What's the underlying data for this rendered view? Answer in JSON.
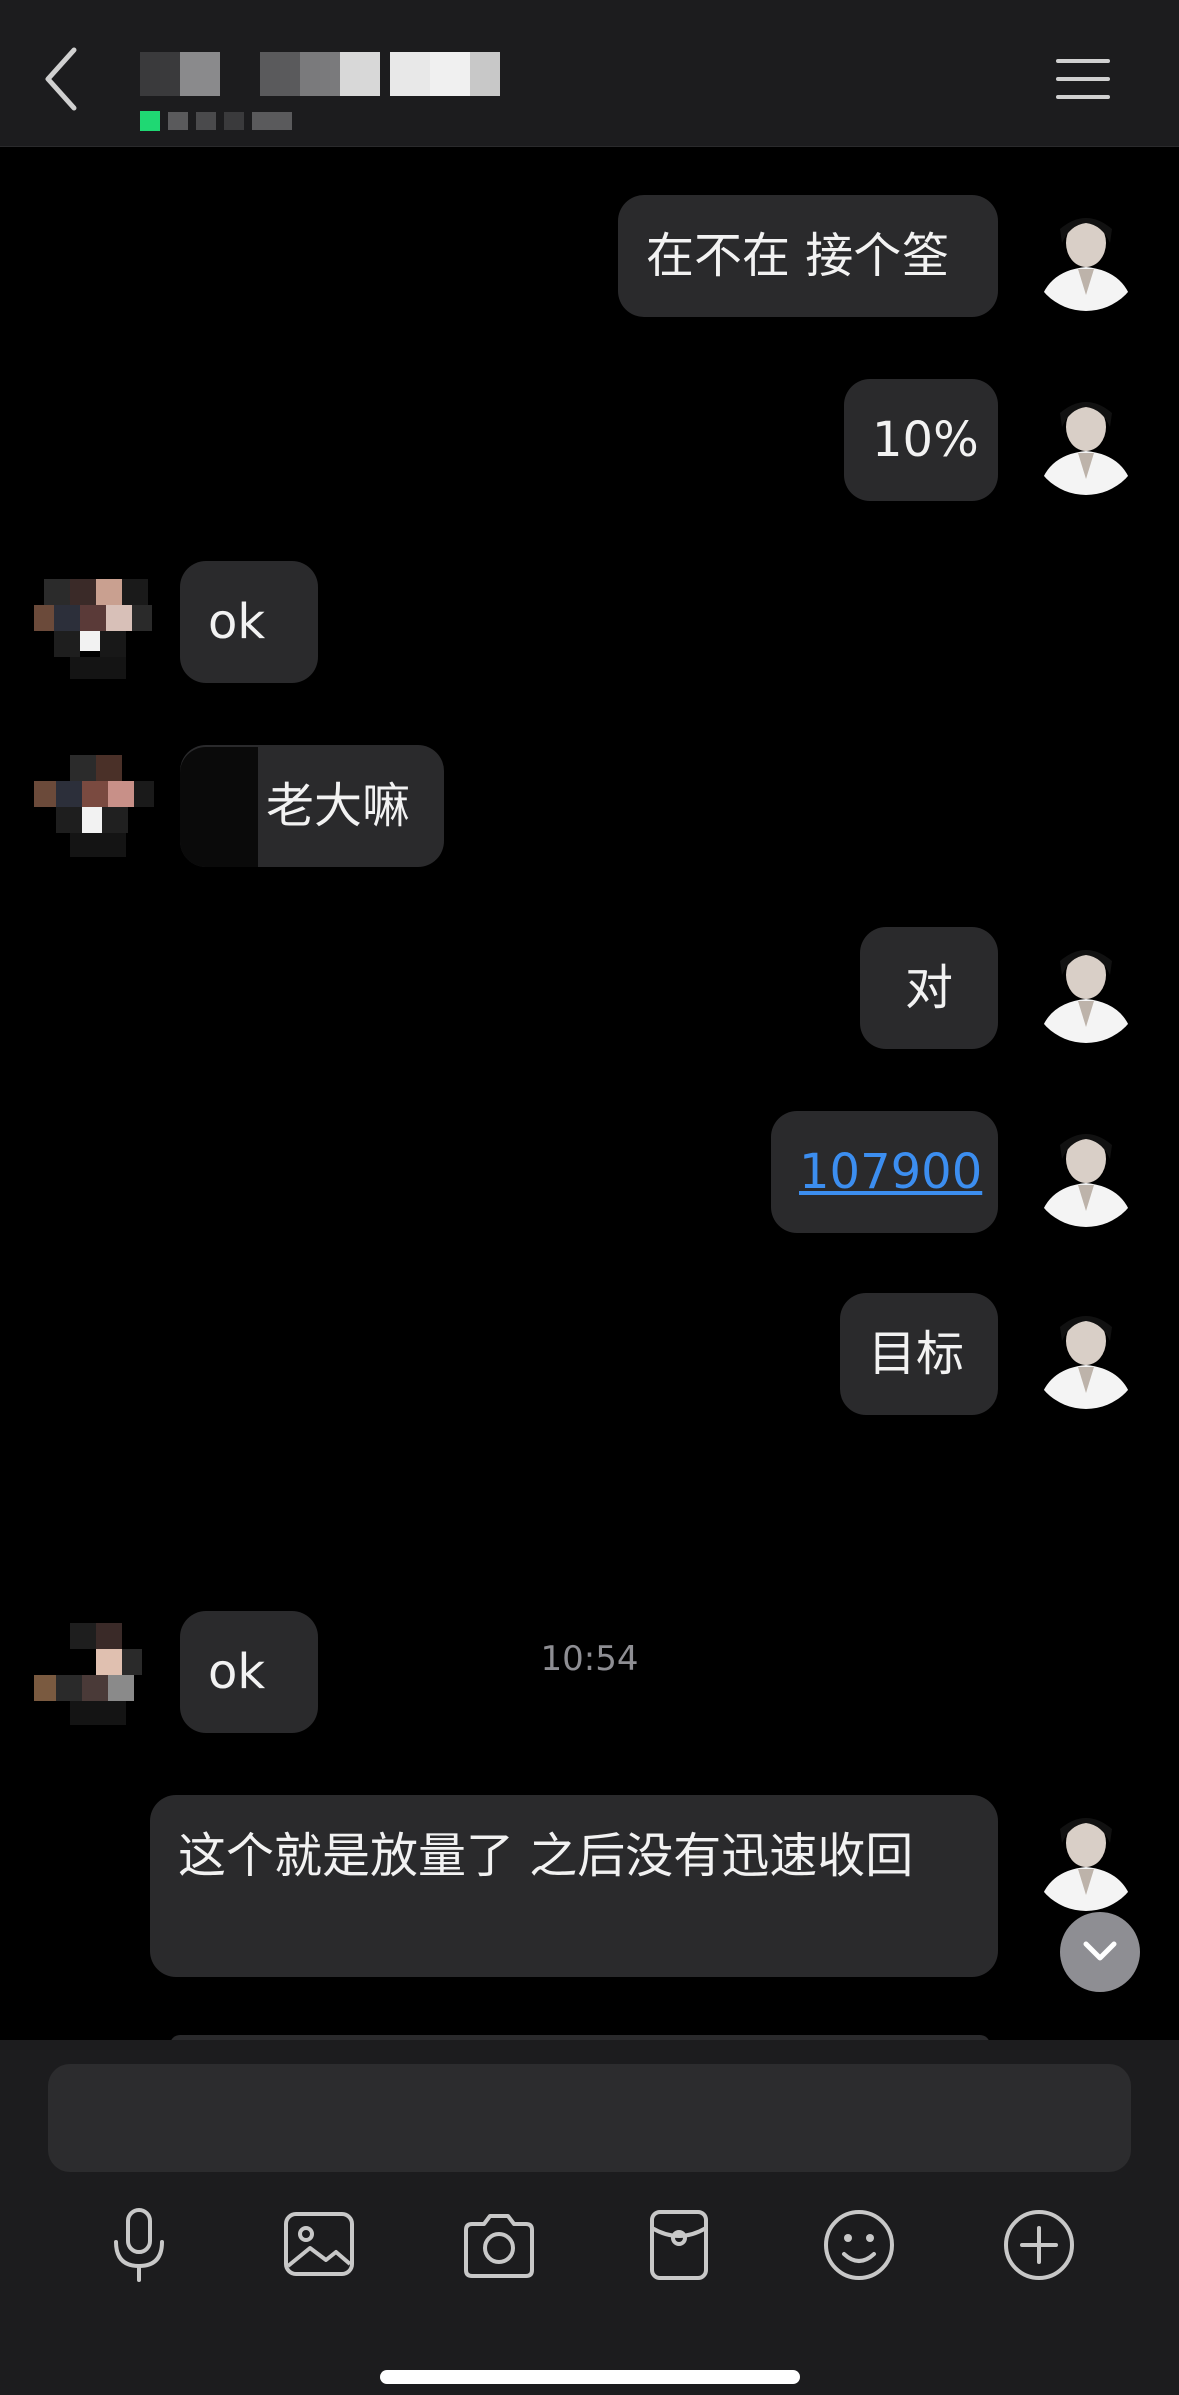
{
  "header": {
    "contact_name_redacted": true
  },
  "messages": [
    {
      "side": "right",
      "text": "在不在 接个筌"
    },
    {
      "side": "right",
      "text": "10%"
    },
    {
      "side": "left",
      "text": "ok"
    },
    {
      "side": "left",
      "text": "老大嘛"
    },
    {
      "side": "right",
      "text": "对"
    },
    {
      "side": "right",
      "text": "107900"
    },
    {
      "side": "right",
      "text": "目标"
    },
    {
      "side": "left",
      "text": "ok"
    },
    {
      "side": "right",
      "text": "这个就是放量了 之后没有迅速收回"
    }
  ],
  "timestamp": "10:54",
  "composer": {
    "placeholder": "",
    "tools": [
      "microphone-icon",
      "image-icon",
      "camera-icon",
      "red-packet-icon",
      "emoji-icon",
      "plus-icon"
    ]
  },
  "colors": {
    "bubble": "#2a2a2c",
    "link": "#3c8ef0",
    "online": "#1fd873"
  }
}
